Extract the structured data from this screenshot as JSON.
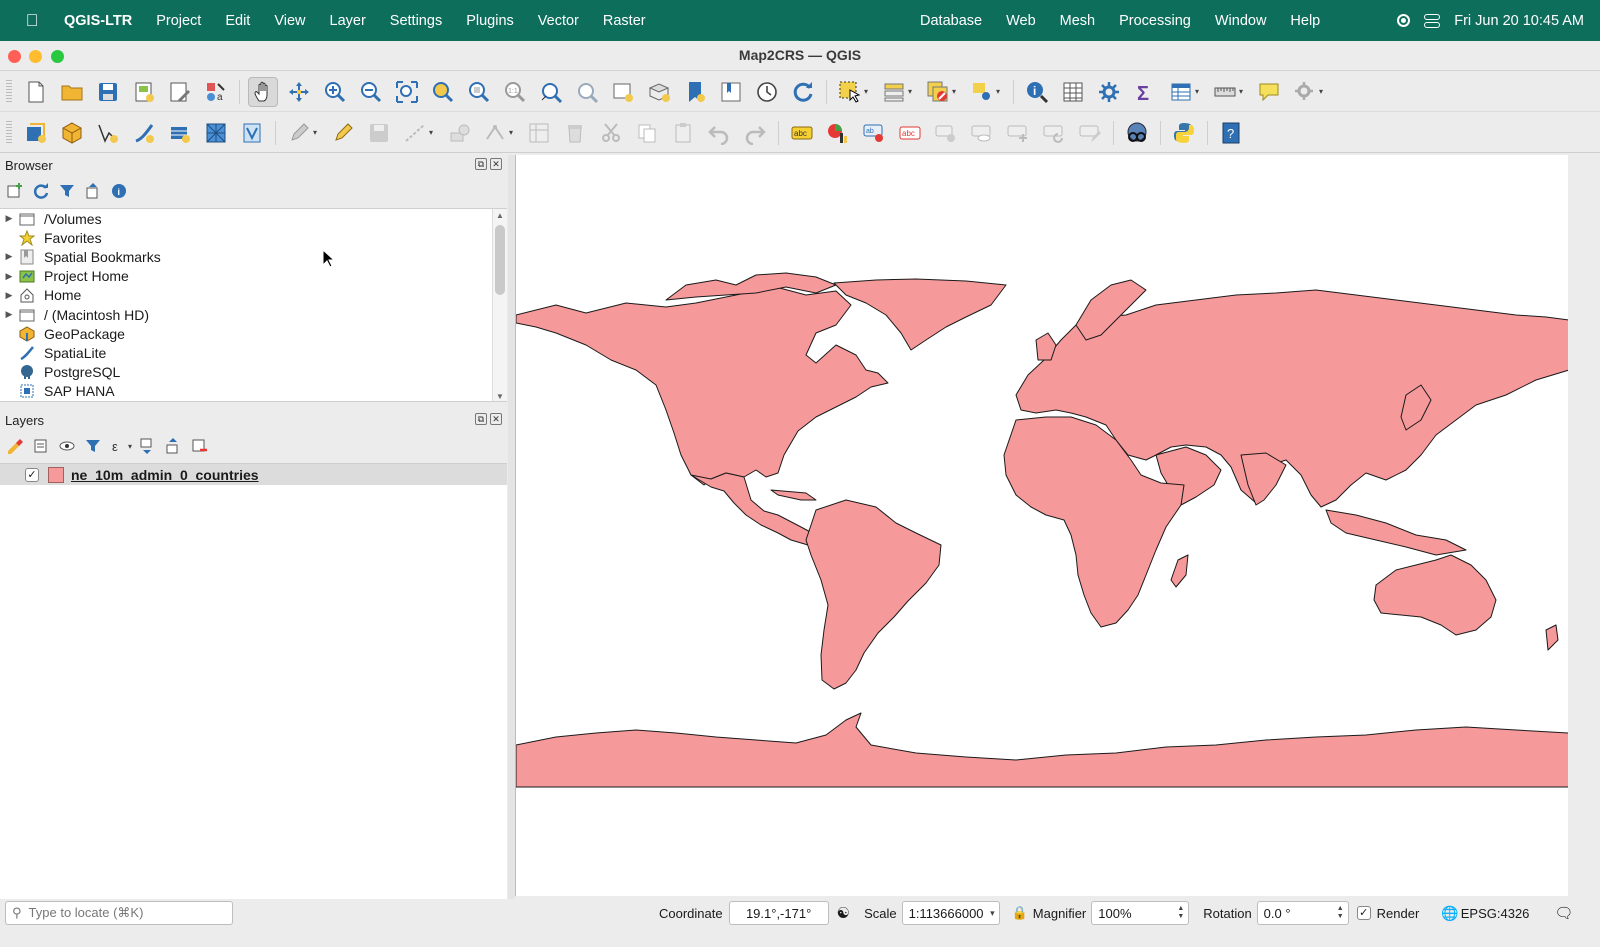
{
  "menubar": {
    "app_name": "QGIS-LTR",
    "items_left": [
      "Project",
      "Edit",
      "View",
      "Layer",
      "Settings",
      "Plugins",
      "Vector",
      "Raster"
    ],
    "items_right": [
      "Database",
      "Web",
      "Mesh",
      "Processing",
      "Window",
      "Help"
    ],
    "clock": "Fri Jun 20  10:45 AM"
  },
  "window": {
    "title": "Map2CRS — QGIS"
  },
  "browser": {
    "title": "Browser",
    "items": [
      {
        "label": "/Volumes",
        "icon": "folder-icon",
        "expandable": true
      },
      {
        "label": "Favorites",
        "icon": "star-icon",
        "expandable": false
      },
      {
        "label": "Spatial Bookmarks",
        "icon": "bookmark-icon",
        "expandable": true
      },
      {
        "label": "Project Home",
        "icon": "project-home-icon",
        "expandable": true
      },
      {
        "label": "Home",
        "icon": "home-icon",
        "expandable": true
      },
      {
        "label": "/ (Macintosh HD)",
        "icon": "folder-icon",
        "expandable": true
      },
      {
        "label": "GeoPackage",
        "icon": "geopackage-icon",
        "expandable": false
      },
      {
        "label": "SpatiaLite",
        "icon": "spatialite-icon",
        "expandable": false
      },
      {
        "label": "PostgreSQL",
        "icon": "postgresql-icon",
        "expandable": false
      },
      {
        "label": "SAP HANA",
        "icon": "sap-hana-icon",
        "expandable": false
      }
    ]
  },
  "layers": {
    "title": "Layers",
    "items": [
      {
        "name": "ne_10m_admin_0_countries",
        "checked": true,
        "fill_color": "#f6999a"
      }
    ]
  },
  "statusbar": {
    "locator_placeholder": "Type to locate (⌘K)",
    "coordinate_label": "Coordinate",
    "coordinate_value": "19.1°,-171°",
    "scale_label": "Scale",
    "scale_value": "1:113666000",
    "magnifier_label": "Magnifier",
    "magnifier_value": "100%",
    "rotation_label": "Rotation",
    "rotation_value": "0.0 °",
    "render_label": "Render",
    "render_checked": true,
    "crs": "EPSG:4326"
  },
  "colors": {
    "menubar": "#0d6e5c",
    "country_fill": "#f6999a",
    "country_stroke": "#1a1a1a"
  }
}
